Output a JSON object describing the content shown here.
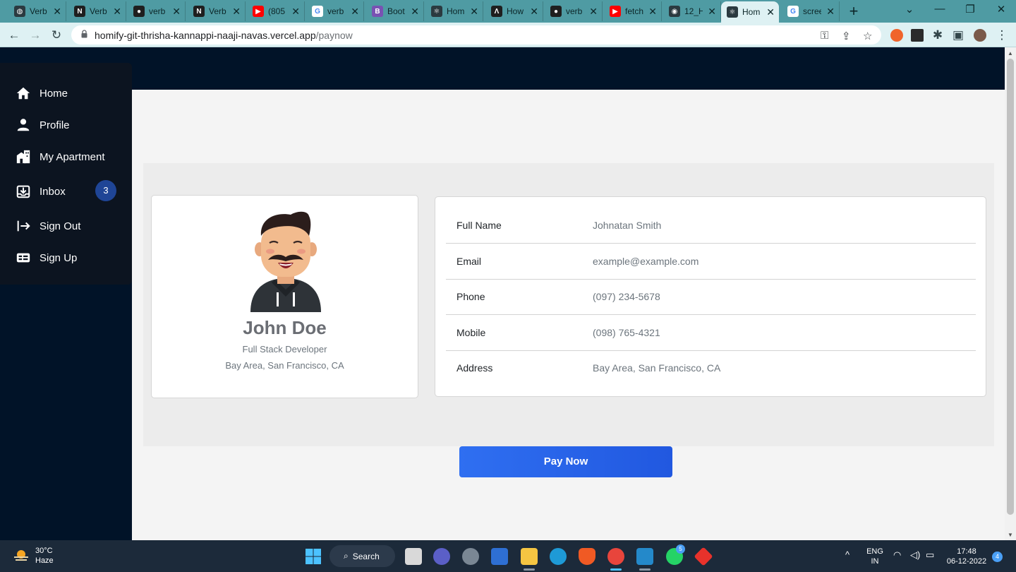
{
  "browser": {
    "tabs": [
      {
        "label": "Verb",
        "favicon": "globe-icon",
        "color": "#2b3a40"
      },
      {
        "label": "Verb",
        "favicon": "notion-icon",
        "color": "#1f1f1f"
      },
      {
        "label": "verb",
        "favicon": "github-icon",
        "color": "#1f1f1f"
      },
      {
        "label": "Verb",
        "favicon": "notion-icon",
        "color": "#1f1f1f"
      },
      {
        "label": "(805",
        "favicon": "youtube-icon",
        "color": "#ff0000"
      },
      {
        "label": "verb",
        "favicon": "google-icon",
        "color": "#4285f4"
      },
      {
        "label": "Boot",
        "favicon": "bootstrap-icon",
        "color": "#7952b3"
      },
      {
        "label": "Hom",
        "favicon": "react-icon",
        "color": "#2b3a40"
      },
      {
        "label": "How",
        "favicon": "angular-icon",
        "color": "#1f1f1f"
      },
      {
        "label": "verb",
        "favicon": "github-icon",
        "color": "#1f1f1f"
      },
      {
        "label": "fetch",
        "favicon": "youtube-icon",
        "color": "#ff0000"
      },
      {
        "label": "12_H",
        "favicon": "chrome-icon",
        "color": "#2b3a40"
      },
      {
        "label": "Hom",
        "favicon": "react-icon",
        "color": "#2b3a40",
        "active": true
      },
      {
        "label": "scree",
        "favicon": "google-icon",
        "color": "#4285f4"
      }
    ],
    "url_host": "homify-git-thrisha-kannappi-naaji-navas.vercel.app",
    "url_path": "/paynow"
  },
  "sidebar": {
    "items": [
      {
        "label": "Home",
        "icon": "home-icon"
      },
      {
        "label": "Profile",
        "icon": "user-icon"
      },
      {
        "label": "My Apartment",
        "icon": "building-icon"
      },
      {
        "label": "Inbox",
        "icon": "inbox-icon",
        "badge": "3"
      },
      {
        "label": "Sign Out",
        "icon": "sign-out-icon"
      },
      {
        "label": "Sign Up",
        "icon": "sign-up-icon"
      }
    ]
  },
  "profile": {
    "name": "John Doe",
    "role": "Full Stack Developer",
    "location": "Bay Area, San Francisco, CA"
  },
  "details": [
    {
      "label": "Full Name",
      "value": "Johnatan Smith"
    },
    {
      "label": "Email",
      "value": "example@example.com"
    },
    {
      "label": "Phone",
      "value": "(097) 234-5678"
    },
    {
      "label": "Mobile",
      "value": "(098) 765-4321"
    },
    {
      "label": "Address",
      "value": "Bay Area, San Francisco, CA"
    }
  ],
  "pay_button": "Pay Now",
  "taskbar": {
    "weather_temp": "30°C",
    "weather_desc": "Haze",
    "search_label": "Search",
    "lang_top": "ENG",
    "lang_bottom": "IN",
    "time": "17:48",
    "date": "06-12-2022",
    "notification_count": "4",
    "whatsapp_badge": "5"
  }
}
